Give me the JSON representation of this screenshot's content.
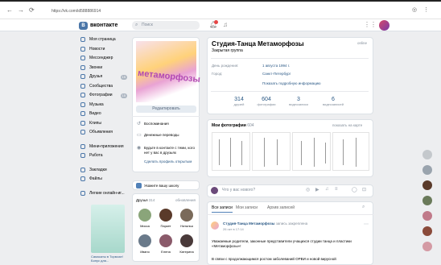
{
  "browser": {
    "url": "https://vk.com/id588886914",
    "nav": [
      "←",
      "→",
      "⟳"
    ]
  },
  "header": {
    "logo_text": "вконтакте",
    "search_placeholder": "Поиск"
  },
  "sidebar": {
    "items": [
      {
        "label": "Моя страница"
      },
      {
        "label": "Новости"
      },
      {
        "label": "Мессенджер"
      },
      {
        "label": "Звонки"
      },
      {
        "label": "Друзья",
        "count": "15"
      },
      {
        "label": "Сообщества"
      },
      {
        "label": "Фотографии",
        "count": "15"
      },
      {
        "label": "Музыка"
      },
      {
        "label": "Видео"
      },
      {
        "label": "Клипы"
      },
      {
        "label": "Объявления"
      }
    ],
    "items2": [
      {
        "label": "Мини-приложения"
      },
      {
        "label": "Работа"
      }
    ],
    "items3": [
      {
        "label": "Закладки"
      },
      {
        "label": "Файлы"
      }
    ],
    "recent_label": "Легкие онлайн-иг...",
    "ad_text": "Самокаты в Тормозе! Бонус для..."
  },
  "profile": {
    "photo_text": "метаморфозы",
    "edit_button": "Редактировать",
    "memories": "Воспоминания",
    "money": "Денежные переводы",
    "contacts_note": "Будьте в контакте с теми, кого нет у вас в друзьях",
    "contacts_link": "Сделать профиль открытым",
    "name": "Студия-Танца Метаморфозы",
    "subtitle": "Закрытая группа",
    "online": "online",
    "info": [
      {
        "label": "День рождения:",
        "value": "1 августа 1994 г."
      },
      {
        "label": "Город:",
        "value": "Санкт-Петербург"
      }
    ],
    "more_info": "Показать подробную информацию",
    "stats": [
      {
        "n": "314",
        "l": "друзей"
      },
      {
        "n": "604",
        "l": "фотографии"
      },
      {
        "n": "3",
        "l": "видеозаписи"
      },
      {
        "n": "6",
        "l": "видеозаписей"
      }
    ]
  },
  "photos_section": {
    "title": "Мои фотографии",
    "count": "604",
    "show_all": "показать на карте"
  },
  "school": {
    "label": "Укажите вашу школу"
  },
  "friends": {
    "title": "Друзья",
    "count": "314",
    "updates": "обновления",
    "list": [
      {
        "name": "Мисса"
      },
      {
        "name": "Паркет"
      },
      {
        "name": "Наталья"
      },
      {
        "name": "Ивано"
      },
      {
        "name": "Елена"
      },
      {
        "name": "Катерина"
      }
    ]
  },
  "composer": {
    "placeholder": "Что у вас нового?"
  },
  "wall": {
    "tabs": [
      "Все записи",
      "Мои записи",
      "Архив записей"
    ],
    "author": "Студия-Танца Метаморфозы",
    "pinned": "запись закреплена",
    "date": "26 окт в 17:14",
    "text1": "Уважаемые родители, законные представители учащихся студии танца и пластики «Метаморфозы»!",
    "text2": "В связи с продолжающимся ростом заболеваний ОРВИ и новой вирусной"
  },
  "colors": {
    "accent": "#4a76a8",
    "link": "#2a5885",
    "page_bg": "#edeef0"
  }
}
